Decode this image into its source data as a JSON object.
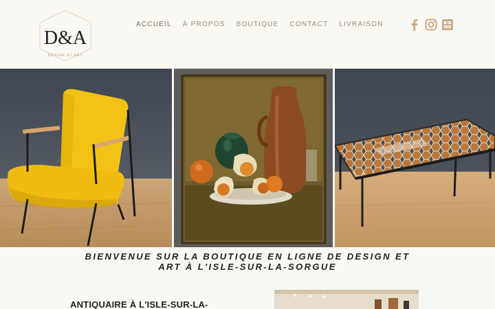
{
  "brand": {
    "logo_mark": "D&A",
    "logo_sub": "DESIGN ET ART"
  },
  "nav": {
    "items": [
      {
        "label": "ACCUEIL",
        "active": true
      },
      {
        "label": "À PROPOS",
        "active": false
      },
      {
        "label": "BOUTIQUE",
        "active": false
      },
      {
        "label": "CONTACT",
        "active": false
      },
      {
        "label": "LIVRAISON",
        "active": false
      }
    ]
  },
  "social": {
    "icons": [
      "facebook-icon",
      "instagram-icon",
      "website-icon"
    ],
    "color": "#c9ab84"
  },
  "gallery": {
    "images": [
      "yellow-armchair-photo",
      "still-life-painting-photo",
      "tiled-coffee-table-photo"
    ]
  },
  "hero": {
    "line1": "BIENVENUE SUR LA BOUTIQUE EN LIGNE DE DESIGN ET",
    "line2": "ART À L'ISLE-SUR-LA-SORGUE"
  },
  "intro": {
    "title": "ANTIQUAIRE À L'ISLE-SUR-LA-"
  },
  "colors": {
    "background": "#faf8f3",
    "accent": "#c9ab84",
    "nav_text": "#9a8a78"
  }
}
